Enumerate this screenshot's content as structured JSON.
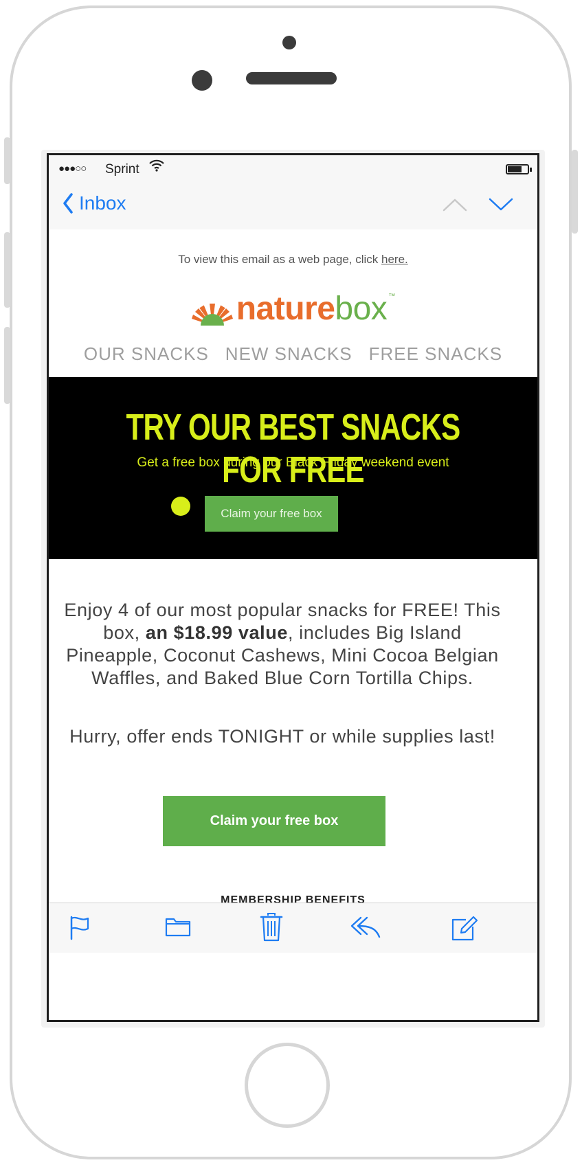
{
  "status_bar": {
    "carrier": "Sprint"
  },
  "navbar": {
    "back_label": "Inbox"
  },
  "email": {
    "webview_text": "To view this email as a web page, click ",
    "webview_link": "here.",
    "logo": {
      "part1": "nature",
      "part2": "box",
      "tm": "™"
    },
    "nav": [
      "OUR SNACKS",
      "NEW SNACKS",
      "FREE SNACKS"
    ],
    "hero": {
      "title": "TRY OUR BEST SNACKS FOR FREE",
      "subtitle": "Get a free box during our Black Friday weekend event",
      "button": "Claim your free box"
    },
    "body": {
      "intro": "Enjoy 4 of our most popular snacks for FREE! This box, ",
      "highlight": "an $18.99 value",
      "rest": ", includes Big Island Pineapple, Coconut Cashews, Mini Cocoa Belgian Waffles, and Baked Blue Corn Tortilla Chips."
    },
    "hurry": "Hurry, offer ends TONIGHT or while supplies last!",
    "cta": "Claim your free box",
    "section_heading": "MEMBERSHIP BENEFITS"
  },
  "toolbar": {
    "icons": [
      "flag-icon",
      "folder-icon",
      "trash-icon",
      "reply-icon",
      "compose-icon"
    ]
  },
  "colors": {
    "ios_blue": "#1e7cf2",
    "brand_orange": "#e86d2c",
    "brand_green": "#6ab04c",
    "hero_yellow": "#d8ee1a",
    "cta_green": "#5fae4b"
  }
}
